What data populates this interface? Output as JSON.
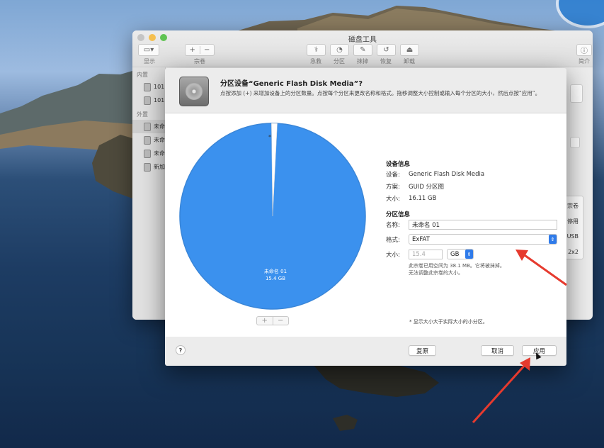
{
  "window": {
    "title": "磁盘工具",
    "toolbar": {
      "view_label": "显示",
      "volume_label": "宗卷",
      "plus": "+",
      "minus": "−",
      "tools": [
        {
          "label": "急救",
          "icon": "first-aid-icon"
        },
        {
          "label": "分区",
          "icon": "partition-icon"
        },
        {
          "label": "抹掉",
          "icon": "erase-icon"
        },
        {
          "label": "恢复",
          "icon": "restore-icon"
        },
        {
          "label": "卸载",
          "icon": "unmount-icon"
        }
      ],
      "info_label": "简介"
    },
    "sidebar": {
      "internal_header": "内置",
      "internal_items": [
        "101",
        "101"
      ],
      "external_header": "外置",
      "external_items": [
        "未命",
        "未命",
        "未命",
        "新加"
      ]
    },
    "right_panel": {
      "lines": [
        "宗卷",
        "停用",
        "USB",
        "2x2"
      ]
    }
  },
  "sheet": {
    "title": "分区设备“Generic Flash Disk Media”?",
    "description": "点按添加 (+) 来增加设备上的分区数量。点按每个分区来更改名称和格式。拖移调整大小控制或输入每个分区的大小，然后点按“应用”。",
    "pie": {
      "name": "未命名 01",
      "size": "15.4 GB",
      "free_marker": "*",
      "main_fraction": 0.99,
      "main_color": "#3b91ee",
      "free_color": "#ffffff"
    },
    "device_info": {
      "title": "设备信息",
      "device_key": "设备:",
      "device_value": "Generic Flash Disk Media",
      "scheme_key": "方案:",
      "scheme_value": "GUID 分区图",
      "size_key": "大小:",
      "size_value": "16.11 GB"
    },
    "partition_info": {
      "title": "分区信息",
      "name_key": "名称:",
      "name_value": "未命名 01",
      "format_key": "格式:",
      "format_value": "ExFAT",
      "size_key": "大小:",
      "size_value": "15.4",
      "unit_value": "GB",
      "note_line1": "此宗卷已用空间为 38.1 MB。它将被抹掉。",
      "note_line2": "无法调整此宗卷的大小。"
    },
    "footnote": "* 显示大小大于实际大小的小分区。",
    "buttons": {
      "plus": "+",
      "minus": "−",
      "help": "?",
      "revert": "复原",
      "cancel": "取消",
      "apply": "应用"
    }
  },
  "annotation_color": "#e63a2e"
}
